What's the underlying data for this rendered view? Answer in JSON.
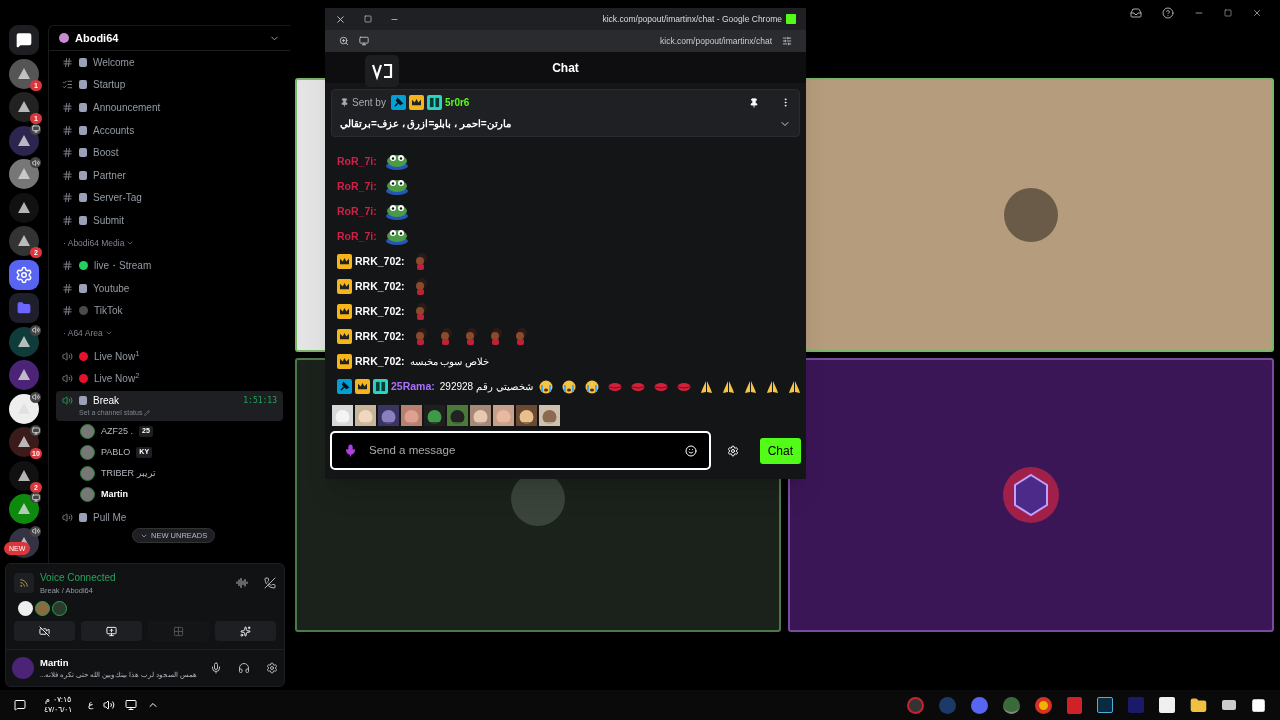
{
  "server_name": "Abodi64",
  "servers": [
    {
      "kind": "home"
    },
    {
      "kind": "server",
      "badge": "1"
    },
    {
      "kind": "server",
      "badge": "1"
    },
    {
      "kind": "server",
      "indicator": {
        "kind": "screen"
      }
    },
    {
      "kind": "server",
      "indicator": {
        "kind": "speaker"
      }
    },
    {
      "kind": "server"
    },
    {
      "kind": "server",
      "badge": "2"
    },
    {
      "kind": "bot"
    },
    {
      "kind": "folder"
    },
    {
      "kind": "server",
      "indicator": {
        "kind": "speaker"
      }
    },
    {
      "kind": "server"
    },
    {
      "kind": "server",
      "indicator": {
        "kind": "speaker"
      }
    },
    {
      "kind": "server",
      "badge": "10",
      "indicator": {
        "kind": "screen"
      }
    },
    {
      "kind": "server",
      "badge": "2"
    },
    {
      "kind": "server",
      "indicator": {
        "kind": "screen"
      }
    },
    {
      "kind": "server",
      "indicator": {
        "kind": "speaker"
      },
      "new": "NEW"
    }
  ],
  "channels": [
    {
      "kind": "text",
      "name": "Welcome"
    },
    {
      "kind": "rules",
      "name": "Startup"
    },
    {
      "kind": "text",
      "name": "Announcement"
    },
    {
      "kind": "text",
      "name": "Accounts"
    },
    {
      "kind": "text",
      "name": "Boost"
    },
    {
      "kind": "text",
      "name": "Partner"
    },
    {
      "kind": "text",
      "name": "Server-Tag"
    },
    {
      "kind": "text",
      "name": "Submit"
    },
    {
      "kind": "category",
      "name": "· Abodi64 Media"
    },
    {
      "kind": "text",
      "name": "live・Stream",
      "color": "#23d160"
    },
    {
      "kind": "text",
      "name": "Youtube"
    },
    {
      "kind": "text",
      "name": "TikTok",
      "color": "#4a4a4a"
    },
    {
      "kind": "category",
      "name": "· A64 Area"
    },
    {
      "kind": "voice",
      "name": "Live Now$^{1}$",
      "color": "#e8112d",
      "selected": false
    },
    {
      "kind": "voice",
      "name": "Live Now$^{2}$",
      "color": "#e8112d",
      "selected": false
    },
    {
      "kind": "voice",
      "name": "Break",
      "selected": true,
      "timer": "1:51:13",
      "status": "Set a channel status",
      "members": [
        {
          "name": "AZF25 .",
          "tag": "25",
          "self": false
        },
        {
          "name": "PABLO",
          "tag": "KY",
          "self": false
        },
        {
          "name": "TRIBER تريبر",
          "self": false
        },
        {
          "name": "Martin",
          "self": true
        }
      ]
    },
    {
      "kind": "voice",
      "name": "Pull Me",
      "selected": false
    }
  ],
  "unreads": "NEW UNREADS",
  "voice": {
    "title": "Voice Connected",
    "location": "Break / Abodi64"
  },
  "user": {
    "name": "Martin",
    "status": "...همس السجود لرب هذا بينك وبين الله حتى تكره فلانه"
  },
  "taskbar": {
    "time": "٠٧:١٥ م",
    "date": "٤٧/٠٦/٠١",
    "language": "ع"
  },
  "popout": {
    "window_title": "kick.com/popout/imartinx/chat - Google Chrome",
    "address": "kick.com/popout/imartinx/chat",
    "header": "Chat",
    "pinned": {
      "label": "Sent by",
      "badges": [
        {
          "kind": "mod"
        },
        {
          "kind": "vip"
        },
        {
          "kind": "og"
        }
      ],
      "user": "5r0r6",
      "text": "مارتن=احمر ، بابلو=ازرق ، عزف=برتقالي"
    },
    "messages": [
      {
        "user": "RoR_7i:",
        "color": "#d0204a",
        "emotes": [
          {
            "kind": "frog"
          }
        ]
      },
      {
        "user": "RoR_7i:",
        "color": "#d0204a",
        "emotes": [
          {
            "kind": "frog"
          }
        ]
      },
      {
        "user": "RoR_7i:",
        "color": "#d0204a",
        "emotes": [
          {
            "kind": "frog"
          }
        ]
      },
      {
        "user": "RoR_7i:",
        "color": "#d0204a",
        "emotes": [
          {
            "kind": "frog"
          }
        ]
      },
      {
        "user": "RRK_702:",
        "color": "#ffffff",
        "badges": [
          {
            "kind": "vip"
          }
        ],
        "emotes": [
          {
            "kind": "girl"
          }
        ]
      },
      {
        "user": "RRK_702:",
        "color": "#ffffff",
        "badges": [
          {
            "kind": "vip"
          }
        ],
        "emotes": [
          {
            "kind": "girl"
          }
        ]
      },
      {
        "user": "RRK_702:",
        "color": "#ffffff",
        "badges": [
          {
            "kind": "vip"
          }
        ],
        "emotes": [
          {
            "kind": "girl"
          }
        ]
      },
      {
        "user": "RRK_702:",
        "color": "#ffffff",
        "badges": [
          {
            "kind": "vip"
          }
        ],
        "emotes": [
          {
            "kind": "girl"
          },
          {
            "kind": "girl"
          },
          {
            "kind": "girl"
          },
          {
            "kind": "girl"
          },
          {
            "kind": "girl"
          }
        ]
      },
      {
        "user": "RRK_702:",
        "color": "#ffffff",
        "badges": [
          {
            "kind": "vip"
          }
        ],
        "text": "خلاص سوب مخبسه"
      },
      {
        "user": "25Rama:",
        "color": "#a970ff",
        "badges": [
          {
            "kind": "mod"
          },
          {
            "kind": "vip"
          },
          {
            "kind": "og"
          }
        ],
        "text": "شخصيتي رقم 292928",
        "emotes": [
          {
            "kind": "cry"
          },
          {
            "kind": "cry"
          },
          {
            "kind": "cry"
          },
          {
            "kind": "lips"
          },
          {
            "kind": "lips"
          },
          {
            "kind": "lips"
          },
          {
            "kind": "lips"
          },
          {
            "kind": "pray"
          },
          {
            "kind": "pray"
          },
          {
            "kind": "pray"
          },
          {
            "kind": "pray"
          },
          {
            "kind": "pray"
          }
        ]
      }
    ],
    "input": {
      "placeholder": "Send a message"
    },
    "send": "Chat"
  }
}
